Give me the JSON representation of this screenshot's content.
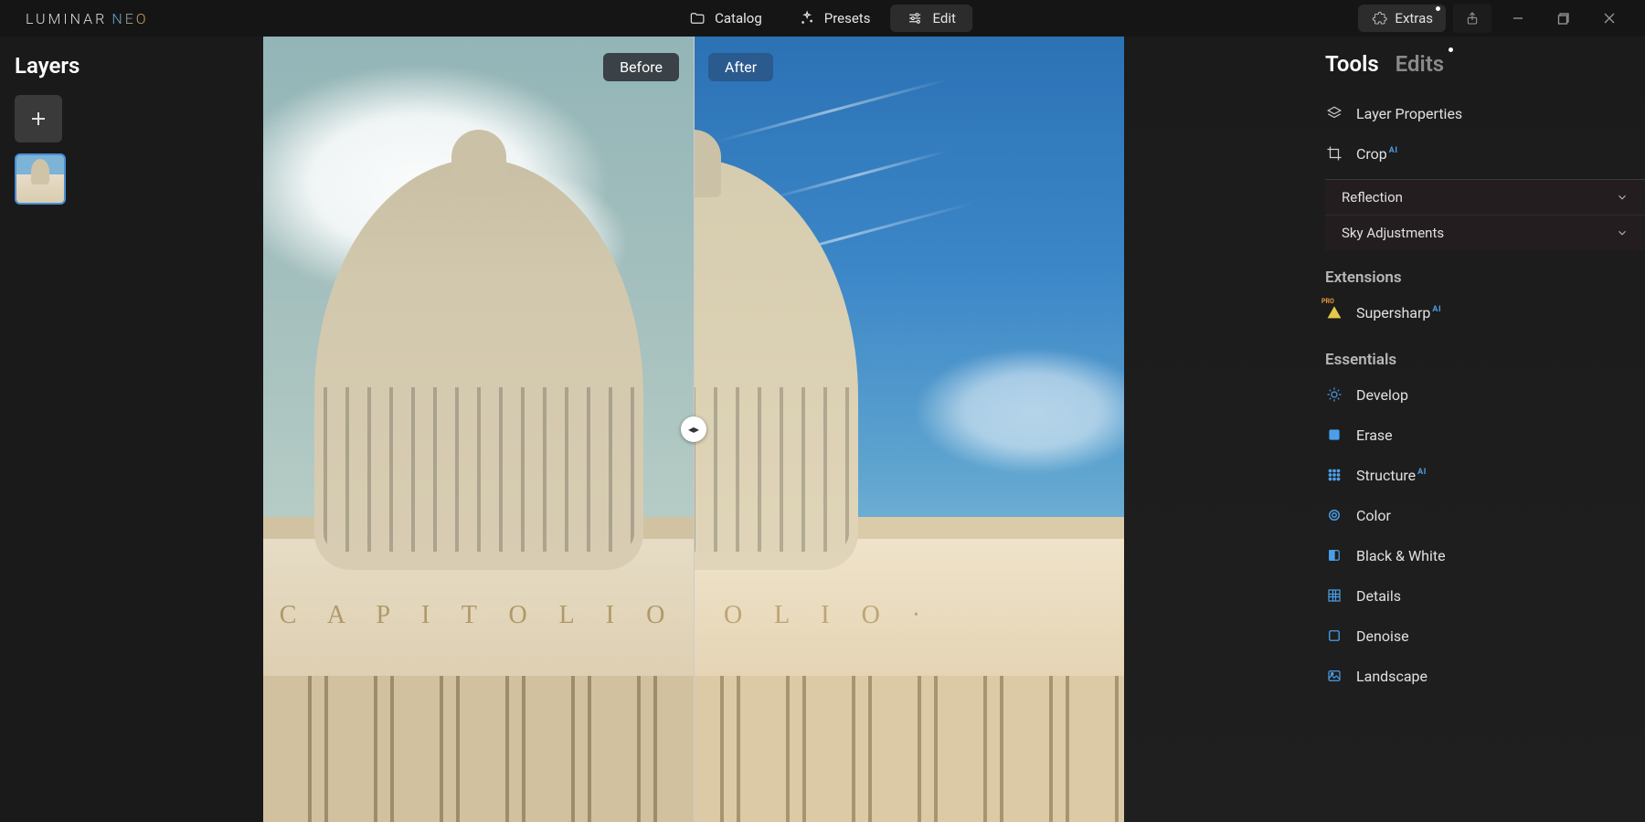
{
  "app": {
    "title_a": "LUMINAR",
    "title_b": " NEO"
  },
  "topbar": {
    "catalog": "Catalog",
    "presets": "Presets",
    "edit": "Edit",
    "extras": "Extras"
  },
  "left": {
    "title": "Layers"
  },
  "canvas": {
    "before": "Before",
    "after": "After",
    "building_text": "· C A P I T O L I O ·"
  },
  "right": {
    "tabs": {
      "tools": "Tools",
      "edits": "Edits"
    },
    "layer_properties": "Layer Properties",
    "crop": "Crop",
    "reflection": "Reflection",
    "sky_adjustments": "Sky Adjustments",
    "extensions_header": "Extensions",
    "supersharp": "Supersharp",
    "essentials_header": "Essentials",
    "develop": "Develop",
    "erase": "Erase",
    "structure": "Structure",
    "color": "Color",
    "bw": "Black & White",
    "details": "Details",
    "denoise": "Denoise",
    "landscape": "Landscape",
    "ai_tag": "AI",
    "pro_tag": "PRO"
  }
}
